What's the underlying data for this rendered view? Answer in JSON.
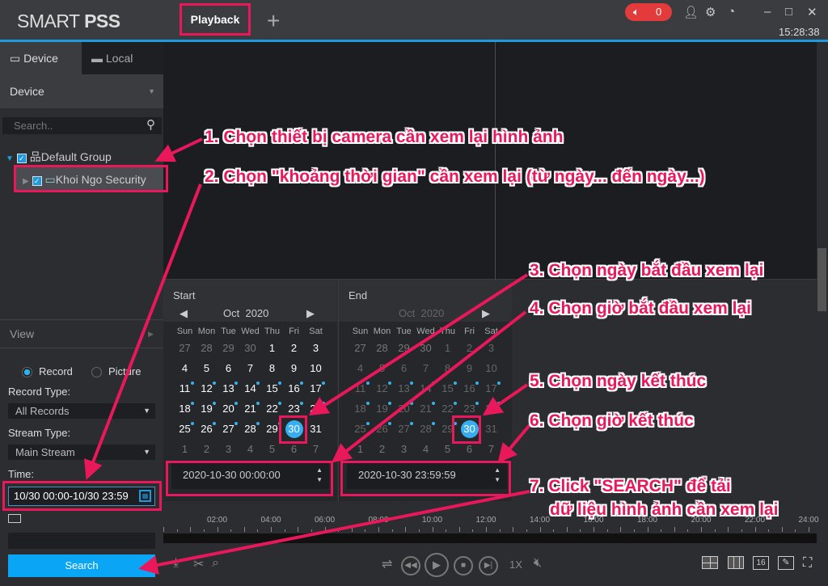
{
  "app": {
    "logo_light": "SMART ",
    "logo_bold": "PSS",
    "tab": "Playback",
    "add_tab": "+",
    "alarm_count": "0",
    "clock": "15:28:38"
  },
  "sidebar": {
    "tabs": [
      "Device",
      "Local"
    ],
    "device_select": "Device",
    "search_placeholder": "Search..",
    "tree": {
      "group": "Default Group",
      "device": "Khoi Ngo Security"
    },
    "view_label": "View",
    "radio_record": "Record",
    "radio_picture": "Picture",
    "record_type_label": "Record Type:",
    "record_type_value": "All Records",
    "stream_type_label": "Stream Type:",
    "stream_type_value": "Main Stream",
    "time_label": "Time:",
    "time_value": "10/30 00:00-10/30 23:59",
    "search_button": "Search"
  },
  "calendar": {
    "weekdays": [
      "Sun",
      "Mon",
      "Tue",
      "Wed",
      "Thu",
      "Fri",
      "Sat"
    ],
    "weeks": [
      [
        27,
        28,
        29,
        30,
        1,
        2,
        3
      ],
      [
        4,
        5,
        6,
        7,
        8,
        9,
        10
      ],
      [
        11,
        12,
        13,
        14,
        15,
        16,
        17
      ],
      [
        18,
        19,
        20,
        21,
        22,
        23,
        24
      ],
      [
        25,
        26,
        27,
        28,
        29,
        30,
        31
      ],
      [
        1,
        2,
        3,
        4,
        5,
        6,
        7
      ]
    ],
    "record_days": [
      11,
      12,
      13,
      14,
      15,
      16,
      17,
      18,
      19,
      20,
      21,
      22,
      23,
      24,
      25,
      26,
      27,
      28,
      29
    ],
    "start": {
      "title": "Start",
      "month": "Oct",
      "year": "2020",
      "selected_day": 30,
      "datetime": "2020-10-30 00:00:00"
    },
    "end": {
      "title": "End",
      "month": "Oct",
      "year": "2020",
      "selected_day": 30,
      "datetime": "2020-10-30 23:59:59"
    }
  },
  "timeline": {
    "labels": [
      "02:00",
      "04:00",
      "06:00",
      "08:00",
      "10:00",
      "12:00",
      "14:00",
      "16:00",
      "18:00",
      "20:00",
      "22:00",
      "24:00"
    ]
  },
  "playback": {
    "speed": "1X",
    "layout_16": "16"
  },
  "annotations": {
    "color": "#e8185a",
    "n1": "1. Chọn thiết bị camera cần xem lại hình ảnh",
    "n2": "2. Chọn \"khoảng thời gian\" cần xem lại (từ ngày... đến ngày...)",
    "n3": "3. Chọn ngày bắt đầu xem lại",
    "n4": "4. Chọn giờ bắt đầu xem lại",
    "n5": "5. Chọn ngày kết thúc",
    "n6": "6. Chọn giờ kết thúc",
    "n7a": "7. Click \"SEARCH\" để tải",
    "n7b": "dữ liệu hình ảnh cần xem lại"
  }
}
